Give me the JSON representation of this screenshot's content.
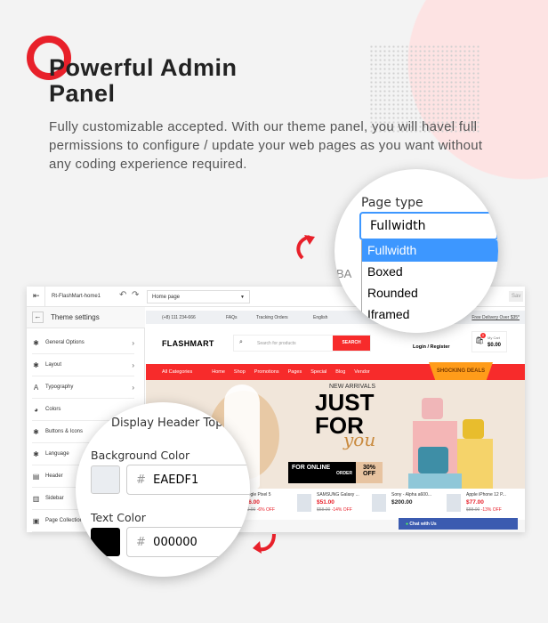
{
  "hero": {
    "title": "Powerful Admin Panel",
    "description": "Fully customizable  accepted. With our theme panel, you will havel full permissions to configure / update your web pages as you want without any coding experience required."
  },
  "topbar": {
    "theme_name": "Rt-FlashMart-home1",
    "page_select": "Home page",
    "save_label": "Sav"
  },
  "sidebar": {
    "title": "Theme settings",
    "items": [
      {
        "label": "General Options",
        "icon": "gear-icon"
      },
      {
        "label": "Layout",
        "icon": "gear-icon"
      },
      {
        "label": "Typography",
        "icon": "typography-icon"
      },
      {
        "label": "Colors",
        "icon": "palette-icon"
      },
      {
        "label": "Buttons & Icons",
        "icon": "gear-icon"
      },
      {
        "label": "Language",
        "icon": "gear-icon"
      },
      {
        "label": "Header",
        "icon": "header-icon"
      },
      {
        "label": "Sidebar",
        "icon": "sidebar-icon"
      },
      {
        "label": "Page Collection",
        "icon": "bag-icon"
      }
    ]
  },
  "store": {
    "phone": "(+8) 111 234-666",
    "faqs": "FAQs",
    "tracking": "Tracking Orders",
    "language": "English",
    "promo": "Free Delivery Over $35*",
    "logo": "FLASHMART",
    "search_placeholder": "Search for products",
    "search_button": "SEARCH",
    "login": "Login / Register",
    "cart_label": "My Cart",
    "cart_total": "$0.00",
    "cart_count": "0",
    "nav": [
      "All Categories",
      "Home",
      "Shop",
      "Promotions",
      "Pages",
      "Special",
      "Blog",
      "Vendor"
    ],
    "deals_badge": "SHOCKING DEALS",
    "banner": {
      "kicker": "NEW ARRIVALS",
      "headline1": "JUST",
      "headline2": "FOR",
      "script": "you",
      "offer1": "FOR ONLINE",
      "offer2": "ORDER",
      "discount": "30% OFF"
    },
    "products": [
      {
        "name": "Google Pixel 5",
        "price": "$56.00",
        "old": "$60.00",
        "off": "-6% OFF"
      },
      {
        "name": "SAMSUNG Galaxy ...",
        "price": "$51.00",
        "old": "$58.00",
        "off": "-14% OFF"
      },
      {
        "name": "Sony - Alpha a600...",
        "price": "$200.00",
        "old": "",
        "off": ""
      },
      {
        "name": "Apple iPhone 12 P...",
        "price": "$77.00",
        "old": "$88.00",
        "off": "-13% OFF"
      }
    ],
    "chat": "Chat with Us"
  },
  "magnifier_page_type": {
    "label": "Page type",
    "value": "Fullwidth",
    "options": [
      "Fullwidth",
      "Boxed",
      "Rounded",
      "Iframed"
    ],
    "selected": "Fullwidth",
    "partial_label": "BA"
  },
  "magnifier_colors": {
    "checkbox_label": "Display Header Top:",
    "bg_label": "Background Color",
    "bg_value": "EAEDF1",
    "bg_color": "#EAEDF1",
    "text_label": "Text Color",
    "text_value": "000000",
    "text_color": "#000000",
    "hash": "#"
  },
  "colors": {
    "accent": "#e8202a",
    "select_highlight": "#3d97ff"
  }
}
